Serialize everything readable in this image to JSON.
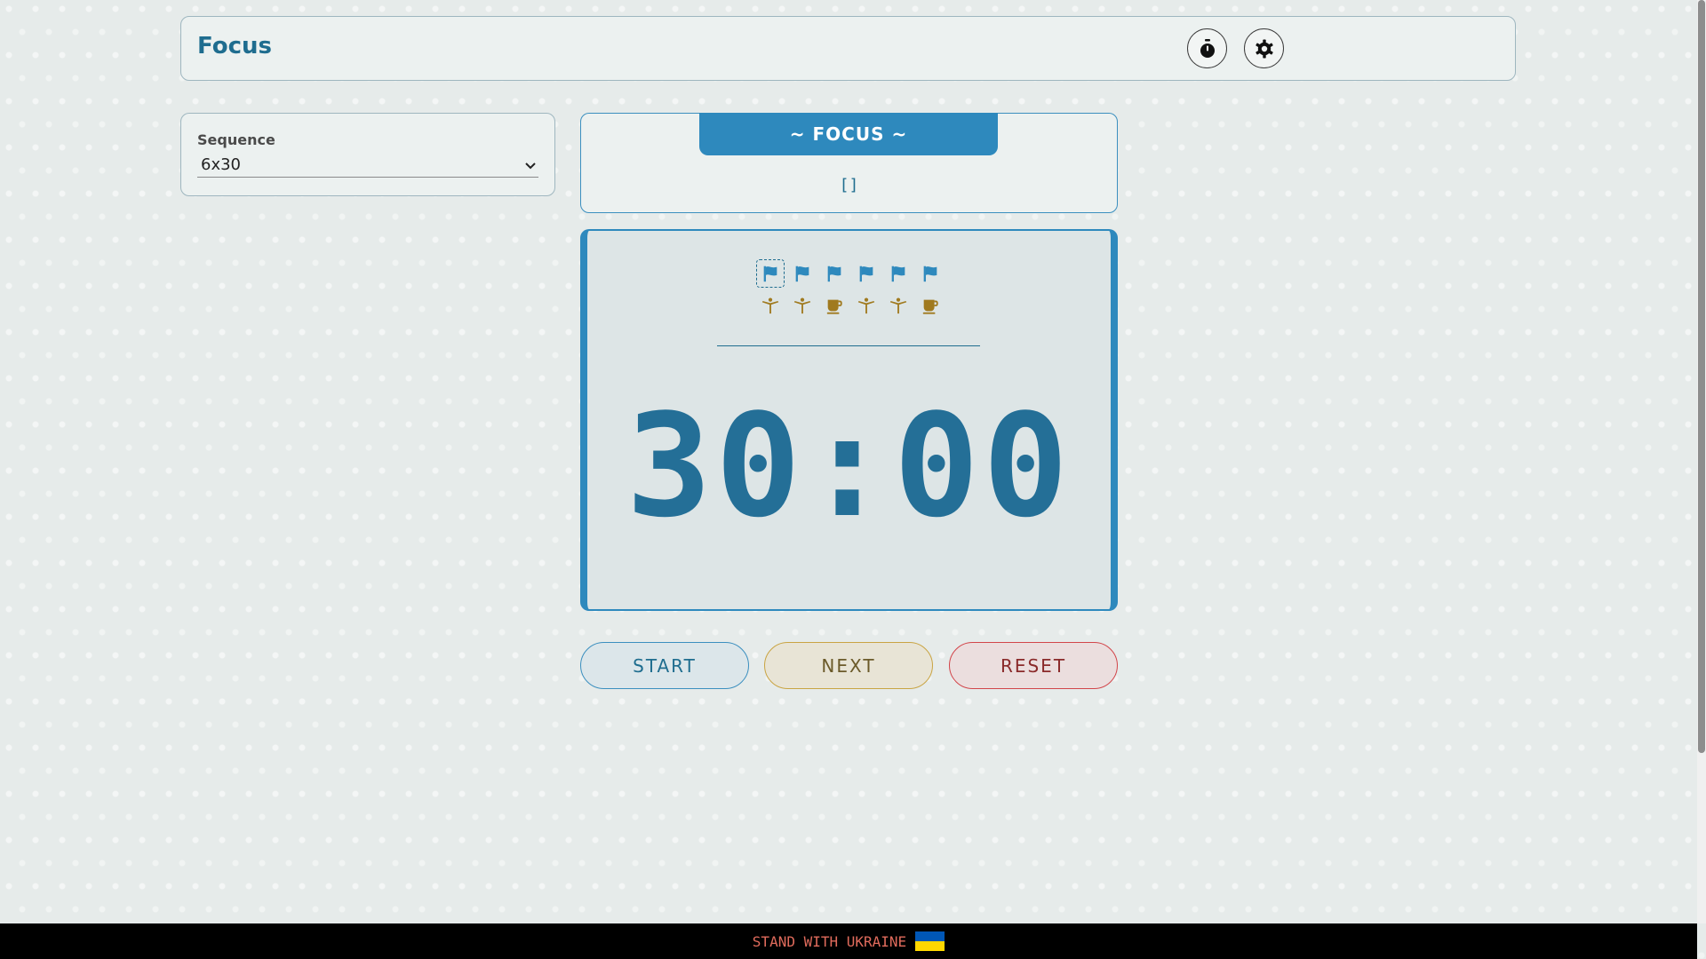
{
  "header": {
    "title": "Focus",
    "timer_icon": "stopwatch-icon",
    "settings_icon": "gear-icon"
  },
  "sequence": {
    "label": "Sequence",
    "value": "6x30"
  },
  "mode": {
    "banner": "~ FOCUS ~",
    "tasks": "[]"
  },
  "timer": {
    "display": "30:00",
    "focus_icons": [
      "flag-icon",
      "flag-icon",
      "flag-icon",
      "flag-icon",
      "flag-icon",
      "flag-icon"
    ],
    "break_icons": [
      "stretch-icon",
      "stretch-icon",
      "coffee-icon",
      "stretch-icon",
      "stretch-icon",
      "coffee-icon"
    ],
    "current_index": 0
  },
  "controls": {
    "start": "START",
    "next": "NEXT",
    "reset": "RESET"
  },
  "footer": {
    "text": "STAND WITH UKRAINE",
    "flag_colors": [
      "#0057b7",
      "#ffd700"
    ]
  },
  "colors": {
    "accent": "#2e89bd",
    "break": "#a07a1f",
    "reset": "#d2454a"
  }
}
